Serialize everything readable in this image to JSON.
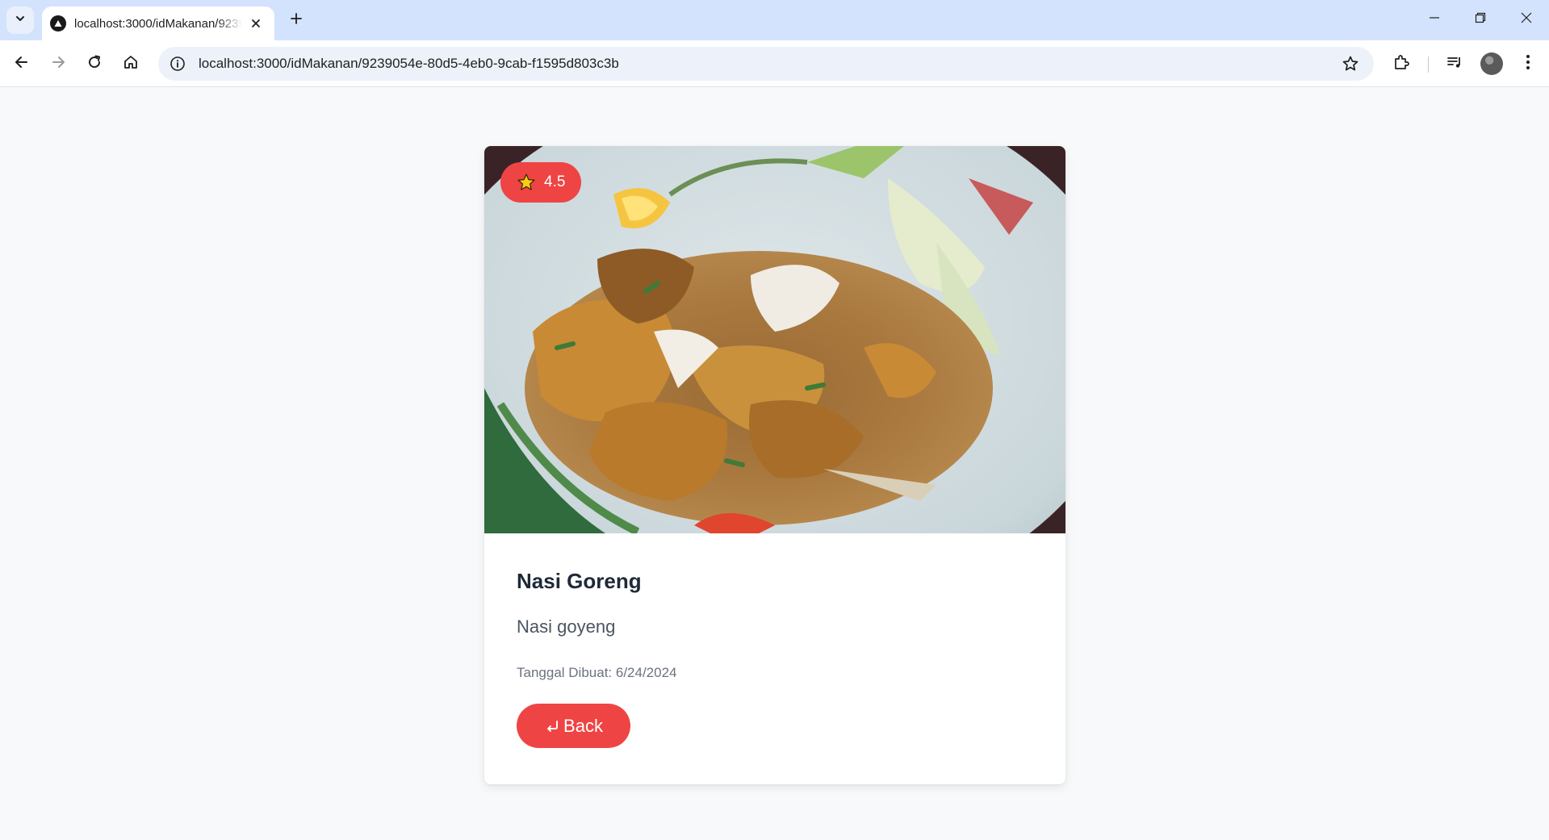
{
  "browser": {
    "tab_title": "localhost:3000/idMakanan/9239054e-80d5-4eb0-9cab-f1595d803c3b",
    "url": "localhost:3000/idMakanan/9239054e-80d5-4eb0-9cab-f1595d803c3b"
  },
  "food": {
    "rating": "4.5",
    "name": "Nasi Goreng",
    "description": "Nasi goyeng",
    "created_label": "Tanggal Dibuat: 6/24/2024",
    "back_label": "Back"
  },
  "colors": {
    "accent": "#ef4444",
    "tabbar": "#d3e3fd",
    "page_bg": "#f8f9fb"
  },
  "icons": [
    "tab-search-icon",
    "app-favicon-icon",
    "close-icon",
    "plus-icon",
    "minimize-icon",
    "restore-icon",
    "back-arrow-icon",
    "forward-arrow-icon",
    "reload-icon",
    "home-icon",
    "info-icon",
    "bookmark-star-icon",
    "extensions-icon",
    "media-queue-icon",
    "avatar",
    "more-vert-icon",
    "star-icon",
    "return-arrow-icon"
  ]
}
